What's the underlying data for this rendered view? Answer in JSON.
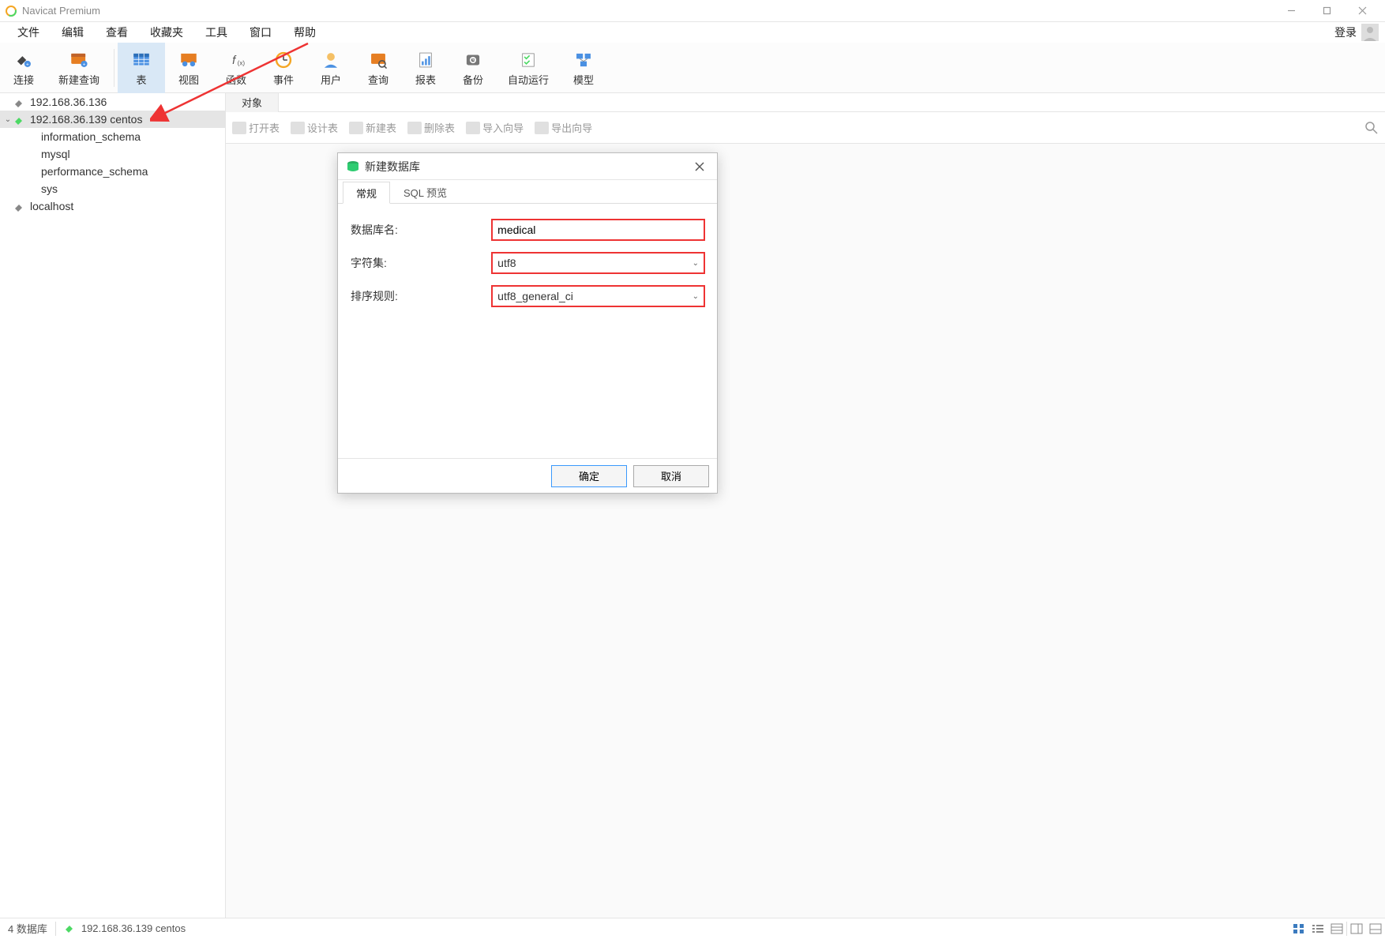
{
  "title": "Navicat Premium",
  "menubar": {
    "items": [
      "文件",
      "编辑",
      "查看",
      "收藏夹",
      "工具",
      "窗口",
      "帮助"
    ],
    "login": "登录"
  },
  "toolbar": {
    "items": [
      {
        "label": "连接",
        "icon": "plug"
      },
      {
        "label": "新建查询",
        "icon": "query"
      },
      {
        "label": "表",
        "icon": "table",
        "sel": true
      },
      {
        "label": "视图",
        "icon": "view"
      },
      {
        "label": "函数",
        "icon": "fx"
      },
      {
        "label": "事件",
        "icon": "event"
      },
      {
        "label": "用户",
        "icon": "user"
      },
      {
        "label": "查询",
        "icon": "search"
      },
      {
        "label": "报表",
        "icon": "report"
      },
      {
        "label": "备份",
        "icon": "backup"
      },
      {
        "label": "自动运行",
        "icon": "auto"
      },
      {
        "label": "模型",
        "icon": "model"
      }
    ]
  },
  "sidebar": {
    "connections": [
      {
        "name": "192.168.36.136",
        "open": false,
        "active": false
      },
      {
        "name": "192.168.36.139  centos",
        "open": true,
        "active": true,
        "selected": true,
        "databases": [
          "information_schema",
          "mysql",
          "performance_schema",
          "sys"
        ]
      },
      {
        "name": "localhost",
        "open": false,
        "active": false
      }
    ]
  },
  "content": {
    "tab": "对象",
    "subtoolbar": [
      "打开表",
      "设计表",
      "新建表",
      "删除表",
      "导入向导",
      "导出向导"
    ]
  },
  "dialog": {
    "title": "新建数据库",
    "tabs": [
      "常规",
      "SQL 预览"
    ],
    "activeTab": 0,
    "fields": {
      "dbname_label": "数据库名:",
      "dbname_value": "medical",
      "charset_label": "字符集:",
      "charset_value": "utf8",
      "collation_label": "排序规则:",
      "collation_value": "utf8_general_ci"
    },
    "buttons": {
      "ok": "确定",
      "cancel": "取消"
    }
  },
  "statusbar": {
    "left": "4 数据库",
    "conn": "192.168.36.139  centos"
  }
}
